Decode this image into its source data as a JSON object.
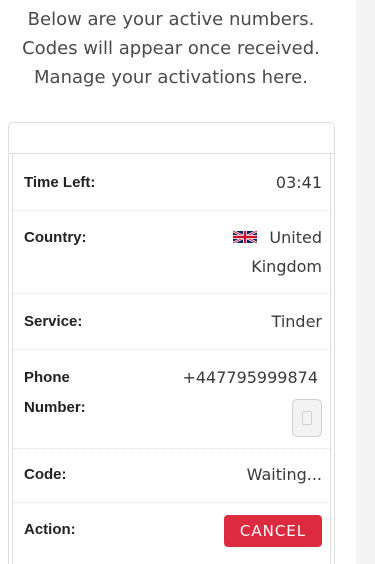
{
  "intro": {
    "lines": [
      "Below are your active numbers.",
      "Codes will appear once received.",
      "Manage your activations here."
    ]
  },
  "activation": {
    "time_left_label": "Time Left:",
    "time_left_value": "03:41",
    "country_label": "Country:",
    "country_value_line1": "United",
    "country_value_line2": "Kingdom",
    "country_flag_icon": "uk-flag-icon",
    "service_label": "Service:",
    "service_value": "Tinder",
    "phone_label_line1": "Phone",
    "phone_label_line2": "Number:",
    "phone_value": "+447795999874",
    "copy_icon": "copy-icon",
    "code_label": "Code:",
    "code_value": "Waiting...",
    "action_label": "Action:",
    "cancel_label": "CANCEL"
  },
  "colors": {
    "cancel_button": "#dc2a3e",
    "border": "#dedede",
    "text": "#333333"
  }
}
